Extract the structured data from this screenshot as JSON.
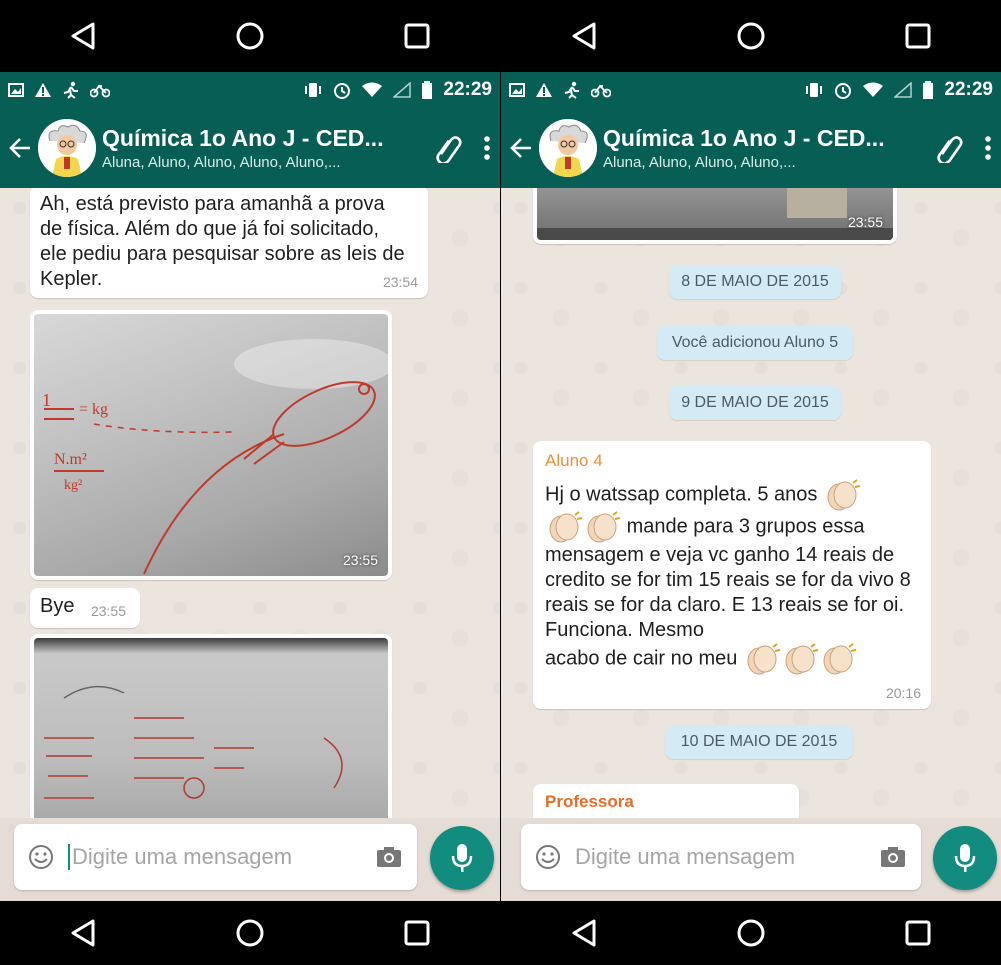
{
  "left": {
    "status": {
      "time": "22:29"
    },
    "header": {
      "title": "Química 1o Ano J - CED...",
      "subtitle": "Aluna, Aluno, Aluno, Aluno, Aluno,..."
    },
    "messages": {
      "m1_text": "Ah, está previsto para amanhã a prova de física. Além do que já foi solicitado,  ele pediu para pesquisar sobre as leis de Kepler.",
      "m1_time": "23:54",
      "photo1_time": "23:55",
      "m2_text": "Bye",
      "m2_time": "23:55"
    },
    "input": {
      "placeholder": "Digite uma mensagem"
    }
  },
  "right": {
    "status": {
      "time": "22:29"
    },
    "header": {
      "title": "Química 1o Ano J - CED...",
      "subtitle": "Aluna, Aluno, Aluno, Aluno,..."
    },
    "messages": {
      "photo_time": "23:55",
      "date1": "8 DE MAIO DE 2015",
      "system": "Você adicionou Aluno 5",
      "date2": "9 DE MAIO DE 2015",
      "sender1": "Aluno 4",
      "line1": "Hj o watssap completa. 5  anos",
      "line2": "mande para 3 grupos essa mensagem e veja vc ganho 14 reais de   credito se for tim 15 reais se for da vivo 8 reais se for da claro. E 13 reais se for oi.  Funciona. Mesmo",
      "line3": "acabo de cair no meu",
      "time1": "20:16",
      "date3": "10 DE MAIO DE 2015",
      "sender2": "Professora"
    },
    "input": {
      "placeholder": "Digite uma mensagem"
    }
  },
  "colors": {
    "header": "#075e54",
    "accent": "#128c7e",
    "chat_bg": "#ece5dd",
    "date_pill": "#d4eaf4",
    "sender": "#f28e3a"
  },
  "icons": [
    "back-arrow-icon",
    "paperclip-icon",
    "more-vert-icon",
    "emoji-icon",
    "camera-icon",
    "mic-icon",
    "clapping-hands-icon"
  ]
}
